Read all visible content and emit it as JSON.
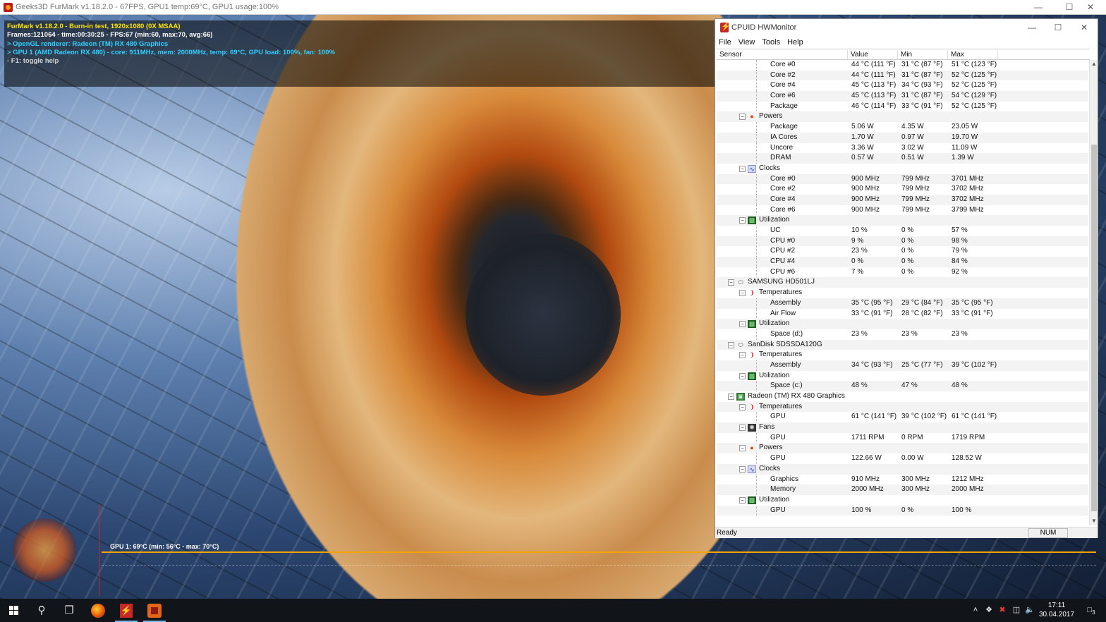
{
  "furmark": {
    "window_title": "Geeks3D FurMark v1.18.2.0 - 67FPS, GPU1 temp:69°C, GPU1 usage:100%",
    "info_lines": [
      {
        "text": "FurMark v1.18.2.0 - Burn-in test, 1920x1080 (0X MSAA)",
        "color": "#ffe400"
      },
      {
        "text": "Frames:121064 - time:00:30:25 - FPS:67 (min:60, max:70, avg:66)",
        "color": "#ffffff"
      },
      {
        "text": "> OpenGL renderer: Radeon (TM) RX 480 Graphics",
        "color": "#2ed0ff"
      },
      {
        "text": "> GPU 1 (AMD Radeon RX 480) - core: 911MHz, mem: 2000MHz, temp: 69°C, GPU load: 100%, fan: 100%",
        "color": "#2ed0ff"
      },
      {
        "text": "- F1: toggle help",
        "color": "#d6d6d6"
      }
    ],
    "graph_label": "GPU 1: 69°C (min: 56°C - max: 70°C)"
  },
  "hwmonitor": {
    "title": "CPUID HWMonitor",
    "menu": [
      "File",
      "View",
      "Tools",
      "Help"
    ],
    "columns": [
      "Sensor",
      "Value",
      "Min",
      "Max"
    ],
    "status": "Ready",
    "num_indicator": "NUM",
    "rows": [
      {
        "level": 3,
        "name": "Core #0",
        "value": "44 °C  (111 °F)",
        "min": "31 °C  (87 °F)",
        "max": "51 °C  (123 °F)"
      },
      {
        "level": 3,
        "name": "Core #2",
        "value": "44 °C  (111 °F)",
        "min": "31 °C  (87 °F)",
        "max": "52 °C  (125 °F)"
      },
      {
        "level": 3,
        "name": "Core #4",
        "value": "45 °C  (113 °F)",
        "min": "34 °C  (93 °F)",
        "max": "52 °C  (125 °F)"
      },
      {
        "level": 3,
        "name": "Core #6",
        "value": "45 °C  (113 °F)",
        "min": "31 °C  (87 °F)",
        "max": "54 °C  (129 °F)"
      },
      {
        "level": 3,
        "name": "Package",
        "value": "46 °C  (114 °F)",
        "min": "33 °C  (91 °F)",
        "max": "52 °C  (125 °F)"
      },
      {
        "level": 2,
        "name": "Powers",
        "icon": "power"
      },
      {
        "level": 3,
        "name": "Package",
        "value": "5.06 W",
        "min": "4.35 W",
        "max": "23.05 W"
      },
      {
        "level": 3,
        "name": "IA Cores",
        "value": "1.70 W",
        "min": "0.97 W",
        "max": "19.70 W"
      },
      {
        "level": 3,
        "name": "Uncore",
        "value": "3.36 W",
        "min": "3.02 W",
        "max": "11.09 W"
      },
      {
        "level": 3,
        "name": "DRAM",
        "value": "0.57 W",
        "min": "0.51 W",
        "max": "1.39 W"
      },
      {
        "level": 2,
        "name": "Clocks",
        "icon": "clock"
      },
      {
        "level": 3,
        "name": "Core #0",
        "value": "900 MHz",
        "min": "799 MHz",
        "max": "3701 MHz"
      },
      {
        "level": 3,
        "name": "Core #2",
        "value": "900 MHz",
        "min": "799 MHz",
        "max": "3702 MHz"
      },
      {
        "level": 3,
        "name": "Core #4",
        "value": "900 MHz",
        "min": "799 MHz",
        "max": "3702 MHz"
      },
      {
        "level": 3,
        "name": "Core #6",
        "value": "900 MHz",
        "min": "799 MHz",
        "max": "3799 MHz"
      },
      {
        "level": 2,
        "name": "Utilization",
        "icon": "util"
      },
      {
        "level": 3,
        "name": "UC",
        "value": "10 %",
        "min": "0 %",
        "max": "57 %"
      },
      {
        "level": 3,
        "name": "CPU #0",
        "value": "9 %",
        "min": "0 %",
        "max": "98 %"
      },
      {
        "level": 3,
        "name": "CPU #2",
        "value": "23 %",
        "min": "0 %",
        "max": "79 %"
      },
      {
        "level": 3,
        "name": "CPU #4",
        "value": "0 %",
        "min": "0 %",
        "max": "84 %"
      },
      {
        "level": 3,
        "name": "CPU #6",
        "value": "7 %",
        "min": "0 %",
        "max": "92 %"
      },
      {
        "level": 1,
        "name": "SAMSUNG HD501LJ",
        "icon": "disk"
      },
      {
        "level": 2,
        "name": "Temperatures",
        "icon": "temp"
      },
      {
        "level": 3,
        "name": "Assembly",
        "value": "35 °C  (95 °F)",
        "min": "29 °C  (84 °F)",
        "max": "35 °C  (95 °F)"
      },
      {
        "level": 3,
        "name": "Air Flow",
        "value": "33 °C  (91 °F)",
        "min": "28 °C  (82 °F)",
        "max": "33 °C  (91 °F)"
      },
      {
        "level": 2,
        "name": "Utilization",
        "icon": "util"
      },
      {
        "level": 3,
        "name": "Space (d:)",
        "value": "23 %",
        "min": "23 %",
        "max": "23 %"
      },
      {
        "level": 1,
        "name": "SanDisk SDSSDA120G",
        "icon": "disk"
      },
      {
        "level": 2,
        "name": "Temperatures",
        "icon": "temp"
      },
      {
        "level": 3,
        "name": "Assembly",
        "value": "34 °C  (93 °F)",
        "min": "25 °C  (77 °F)",
        "max": "39 °C  (102 °F)"
      },
      {
        "level": 2,
        "name": "Utilization",
        "icon": "util"
      },
      {
        "level": 3,
        "name": "Space (c:)",
        "value": "48 %",
        "min": "47 %",
        "max": "48 %"
      },
      {
        "level": 1,
        "name": "Radeon (TM) RX 480 Graphics",
        "icon": "gpu"
      },
      {
        "level": 2,
        "name": "Temperatures",
        "icon": "temp"
      },
      {
        "level": 3,
        "name": "GPU",
        "value": "61 °C  (141 °F)",
        "min": "39 °C  (102 °F)",
        "max": "61 °C  (141 °F)"
      },
      {
        "level": 2,
        "name": "Fans",
        "icon": "fan"
      },
      {
        "level": 3,
        "name": "GPU",
        "value": "1711 RPM",
        "min": "0 RPM",
        "max": "1719 RPM"
      },
      {
        "level": 2,
        "name": "Powers",
        "icon": "power"
      },
      {
        "level": 3,
        "name": "GPU",
        "value": "122.66 W",
        "min": "0.00 W",
        "max": "128.52 W"
      },
      {
        "level": 2,
        "name": "Clocks",
        "icon": "clock"
      },
      {
        "level": 3,
        "name": "Graphics",
        "value": "910 MHz",
        "min": "300 MHz",
        "max": "1212 MHz"
      },
      {
        "level": 3,
        "name": "Memory",
        "value": "2000 MHz",
        "min": "300 MHz",
        "max": "2000 MHz"
      },
      {
        "level": 2,
        "name": "Utilization",
        "icon": "util"
      },
      {
        "level": 3,
        "name": "GPU",
        "value": "100 %",
        "min": "0 %",
        "max": "100 %"
      }
    ]
  },
  "taskbar": {
    "apps": [
      {
        "name": "start-button",
        "icon": "windows-logo-icon"
      },
      {
        "name": "search-button",
        "icon": "search-icon"
      },
      {
        "name": "task-view-button",
        "icon": "task-view-icon"
      },
      {
        "name": "firefox-button",
        "icon": "firefox-icon"
      },
      {
        "name": "hwmonitor-button",
        "icon": "hwmonitor-icon"
      },
      {
        "name": "furmark-button",
        "icon": "furmark-icon"
      }
    ],
    "time": "17:11",
    "date": "30.04.2017",
    "notification_count": "3"
  }
}
